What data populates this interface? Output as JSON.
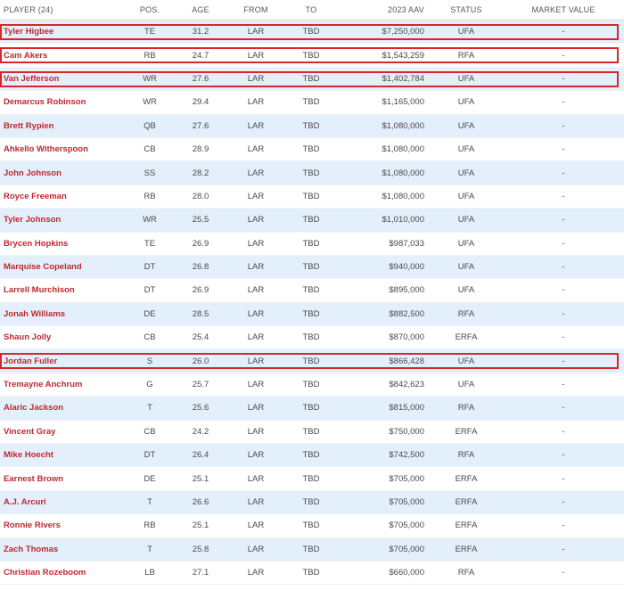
{
  "headers": {
    "player": "PLAYER (24)",
    "pos": "POS.",
    "age": "AGE",
    "from": "FROM",
    "to": "TO",
    "aav": "2023 AAV",
    "status": "STATUS",
    "market_value": "MARKET VALUE"
  },
  "rows": [
    {
      "player": "Tyler Higbee",
      "pos": "TE",
      "age": "31.2",
      "from": "LAR",
      "to": "TBD",
      "aav": "$7,250,000",
      "status": "UFA",
      "market_value": "-",
      "highlighted": true
    },
    {
      "player": "Cam Akers",
      "pos": "RB",
      "age": "24.7",
      "from": "LAR",
      "to": "TBD",
      "aav": "$1,543,259",
      "status": "RFA",
      "market_value": "-",
      "highlighted": true
    },
    {
      "player": "Van Jefferson",
      "pos": "WR",
      "age": "27.6",
      "from": "LAR",
      "to": "TBD",
      "aav": "$1,402,784",
      "status": "UFA",
      "market_value": "-",
      "highlighted": true
    },
    {
      "player": "Demarcus Robinson",
      "pos": "WR",
      "age": "29.4",
      "from": "LAR",
      "to": "TBD",
      "aav": "$1,165,000",
      "status": "UFA",
      "market_value": "-",
      "highlighted": false
    },
    {
      "player": "Brett Rypien",
      "pos": "QB",
      "age": "27.6",
      "from": "LAR",
      "to": "TBD",
      "aav": "$1,080,000",
      "status": "UFA",
      "market_value": "-",
      "highlighted": false
    },
    {
      "player": "Ahkello Witherspoon",
      "pos": "CB",
      "age": "28.9",
      "from": "LAR",
      "to": "TBD",
      "aav": "$1,080,000",
      "status": "UFA",
      "market_value": "-",
      "highlighted": false
    },
    {
      "player": "John Johnson",
      "pos": "SS",
      "age": "28.2",
      "from": "LAR",
      "to": "TBD",
      "aav": "$1,080,000",
      "status": "UFA",
      "market_value": "-",
      "highlighted": false
    },
    {
      "player": "Royce Freeman",
      "pos": "RB",
      "age": "28.0",
      "from": "LAR",
      "to": "TBD",
      "aav": "$1,080,000",
      "status": "UFA",
      "market_value": "-",
      "highlighted": false
    },
    {
      "player": "Tyler Johnson",
      "pos": "WR",
      "age": "25.5",
      "from": "LAR",
      "to": "TBD",
      "aav": "$1,010,000",
      "status": "UFA",
      "market_value": "-",
      "highlighted": false
    },
    {
      "player": "Brycen Hopkins",
      "pos": "TE",
      "age": "26.9",
      "from": "LAR",
      "to": "TBD",
      "aav": "$987,033",
      "status": "UFA",
      "market_value": "-",
      "highlighted": false
    },
    {
      "player": "Marquise Copeland",
      "pos": "DT",
      "age": "26.8",
      "from": "LAR",
      "to": "TBD",
      "aav": "$940,000",
      "status": "UFA",
      "market_value": "-",
      "highlighted": false
    },
    {
      "player": "Larrell Murchison",
      "pos": "DT",
      "age": "26.9",
      "from": "LAR",
      "to": "TBD",
      "aav": "$895,000",
      "status": "UFA",
      "market_value": "-",
      "highlighted": false
    },
    {
      "player": "Jonah Williams",
      "pos": "DE",
      "age": "28.5",
      "from": "LAR",
      "to": "TBD",
      "aav": "$882,500",
      "status": "RFA",
      "market_value": "-",
      "highlighted": false
    },
    {
      "player": "Shaun Jolly",
      "pos": "CB",
      "age": "25.4",
      "from": "LAR",
      "to": "TBD",
      "aav": "$870,000",
      "status": "ERFA",
      "market_value": "-",
      "highlighted": false
    },
    {
      "player": "Jordan Fuller",
      "pos": "S",
      "age": "26.0",
      "from": "LAR",
      "to": "TBD",
      "aav": "$866,428",
      "status": "UFA",
      "market_value": "-",
      "highlighted": true
    },
    {
      "player": "Tremayne Anchrum",
      "pos": "G",
      "age": "25.7",
      "from": "LAR",
      "to": "TBD",
      "aav": "$842,623",
      "status": "UFA",
      "market_value": "-",
      "highlighted": false
    },
    {
      "player": "Alaric Jackson",
      "pos": "T",
      "age": "25.6",
      "from": "LAR",
      "to": "TBD",
      "aav": "$815,000",
      "status": "RFA",
      "market_value": "-",
      "highlighted": false
    },
    {
      "player": "Vincent Gray",
      "pos": "CB",
      "age": "24.2",
      "from": "LAR",
      "to": "TBD",
      "aav": "$750,000",
      "status": "ERFA",
      "market_value": "-",
      "highlighted": false
    },
    {
      "player": "Mike Hoecht",
      "pos": "DT",
      "age": "26.4",
      "from": "LAR",
      "to": "TBD",
      "aav": "$742,500",
      "status": "RFA",
      "market_value": "-",
      "highlighted": false
    },
    {
      "player": "Earnest Brown",
      "pos": "DE",
      "age": "25.1",
      "from": "LAR",
      "to": "TBD",
      "aav": "$705,000",
      "status": "ERFA",
      "market_value": "-",
      "highlighted": false
    },
    {
      "player": "A.J. Arcuri",
      "pos": "T",
      "age": "26.6",
      "from": "LAR",
      "to": "TBD",
      "aav": "$705,000",
      "status": "ERFA",
      "market_value": "-",
      "highlighted": false
    },
    {
      "player": "Ronnie Rivers",
      "pos": "RB",
      "age": "25.1",
      "from": "LAR",
      "to": "TBD",
      "aav": "$705,000",
      "status": "ERFA",
      "market_value": "-",
      "highlighted": false
    },
    {
      "player": "Zach Thomas",
      "pos": "T",
      "age": "25.8",
      "from": "LAR",
      "to": "TBD",
      "aav": "$705,000",
      "status": "ERFA",
      "market_value": "-",
      "highlighted": false
    },
    {
      "player": "Christian Rozeboom",
      "pos": "LB",
      "age": "27.1",
      "from": "LAR",
      "to": "TBD",
      "aav": "$660,000",
      "status": "RFA",
      "market_value": "-",
      "highlighted": false
    }
  ],
  "colors": {
    "player_link": "#c0282e",
    "row_stripe": "#e3effb",
    "highlight_border": "#d9262c"
  }
}
